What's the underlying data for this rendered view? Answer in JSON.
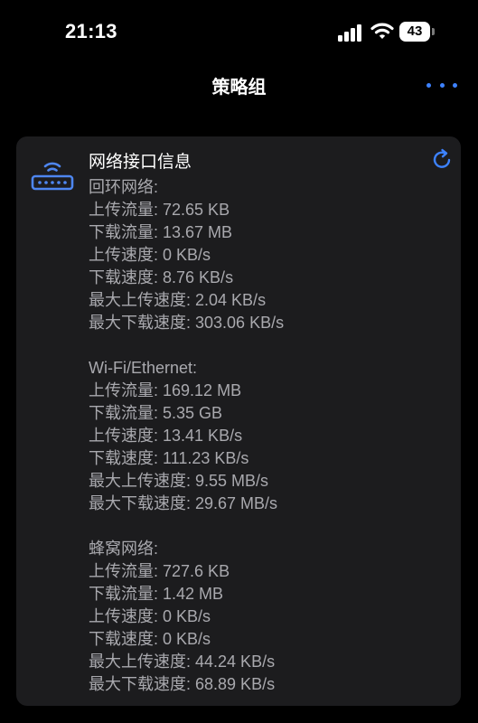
{
  "status_bar": {
    "time": "21:13",
    "battery_level": "43",
    "signal_icon": "cellular-signal-icon",
    "wifi_icon": "wifi-icon",
    "battery_icon": "battery-icon"
  },
  "nav": {
    "title": "策略组",
    "more_icon": "ellipsis-icon"
  },
  "card": {
    "title": "网络接口信息",
    "icon": "router-icon",
    "refresh_icon": "refresh-icon",
    "sections": [
      {
        "header": "回环网络:",
        "stats": [
          {
            "label": "上传流量:",
            "value": "72.65 KB"
          },
          {
            "label": "下载流量:",
            "value": "13.67 MB"
          },
          {
            "label": "上传速度:",
            "value": "0 KB/s"
          },
          {
            "label": "下载速度:",
            "value": "8.76 KB/s"
          },
          {
            "label": "最大上传速度:",
            "value": "2.04 KB/s"
          },
          {
            "label": "最大下载速度:",
            "value": "303.06 KB/s"
          }
        ]
      },
      {
        "header": "Wi-Fi/Ethernet:",
        "stats": [
          {
            "label": "上传流量:",
            "value": "169.12 MB"
          },
          {
            "label": "下载流量:",
            "value": "5.35 GB"
          },
          {
            "label": "上传速度:",
            "value": "13.41 KB/s"
          },
          {
            "label": "下载速度:",
            "value": "111.23 KB/s"
          },
          {
            "label": "最大上传速度:",
            "value": "9.55 MB/s"
          },
          {
            "label": "最大下载速度:",
            "value": "29.67 MB/s"
          }
        ]
      },
      {
        "header": "蜂窝网络:",
        "stats": [
          {
            "label": "上传流量:",
            "value": "727.6 KB"
          },
          {
            "label": "下载流量:",
            "value": "1.42 MB"
          },
          {
            "label": "上传速度:",
            "value": "0 KB/s"
          },
          {
            "label": "下载速度:",
            "value": "0 KB/s"
          },
          {
            "label": "最大上传速度:",
            "value": "44.24 KB/s"
          },
          {
            "label": "最大下载速度:",
            "value": "68.89 KB/s"
          }
        ]
      }
    ]
  },
  "colors": {
    "background": "#000000",
    "card": "#1c1c1e",
    "accent": "#3d82ff",
    "secondary_text": "#a9a9ae",
    "primary_text": "#ffffff"
  }
}
